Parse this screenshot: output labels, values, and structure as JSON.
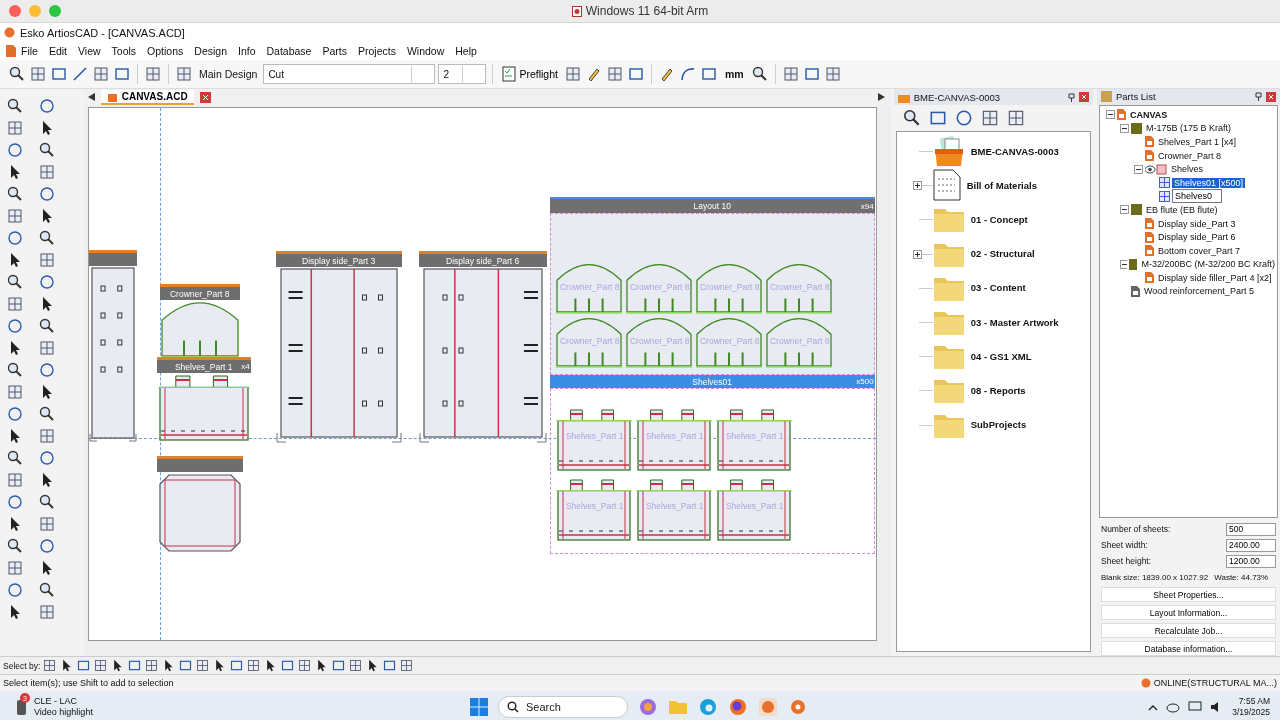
{
  "host_window": {
    "title": "Windows 11 64-bit Arm"
  },
  "app_title": "Esko ArtiosCAD - [CANVAS.ACD]",
  "menu": [
    "File",
    "Edit",
    "View",
    "Tools",
    "Options",
    "Design",
    "Info",
    "Database",
    "Parts",
    "Projects",
    "Window",
    "Help"
  ],
  "toolbar": {
    "design_label": "Main Design",
    "mode_select": {
      "value": "Cut"
    },
    "step_select": {
      "value": "2"
    },
    "preflight": "Preflight",
    "units": "mm"
  },
  "document_tab": {
    "label": "CANVAS.ACD",
    "selected": true
  },
  "canvas": {
    "designs": [
      {
        "kind": "side-panel"
      },
      {
        "kind": "crowner",
        "label": "Crowner_Part 8"
      },
      {
        "kind": "shelf",
        "label": "Shelves_Part 1",
        "count": "x4"
      },
      {
        "kind": "bottom"
      },
      {
        "kind": "display-side",
        "label": "Display side_Part 3"
      },
      {
        "kind": "display-side",
        "label": "Display side_Part 6"
      }
    ],
    "layout": {
      "title": "Layout 10",
      "count": "x94",
      "sheet": {
        "title": "Shelves01",
        "count": "x500"
      },
      "upper_parts": [
        "Crowner_Part 8",
        "Crowner_Part 8",
        "Crowner_Part 8",
        "Crowner_Part 8",
        "Crowner_Part 8",
        "Crowner_Part 8",
        "Crowner_Part 8",
        "Crowner_Part 8"
      ],
      "lower_parts": [
        "Shelves_Part 1",
        "Shelves_Part 1",
        "Shelves_Part 1",
        "Shelves_Part 1",
        "Shelves_Part 1",
        "Shelves_Part 1"
      ]
    }
  },
  "project_panel": {
    "title": "BME-CANVAS-0003",
    "items": [
      {
        "kind": "project",
        "label": "BME-CANVAS-0003",
        "expander": false
      },
      {
        "kind": "document",
        "label": "Bill of Materials",
        "expander": true
      },
      {
        "kind": "folder",
        "label": "01 - Concept",
        "expander": false
      },
      {
        "kind": "folder",
        "label": "02 - Structural",
        "expander": true
      },
      {
        "kind": "folder",
        "label": "03 - Content",
        "expander": false
      },
      {
        "kind": "folder",
        "label": "03 - Master Artwork",
        "expander": false
      },
      {
        "kind": "folder",
        "label": "04 - GS1 XML",
        "expander": false
      },
      {
        "kind": "folder",
        "label": "08 - Reports",
        "expander": false
      },
      {
        "kind": "folder",
        "label": "SubProjects",
        "expander": false
      }
    ]
  },
  "parts_list": {
    "title": "Parts List",
    "tree": [
      {
        "kind": "document",
        "label": "CANVAS",
        "selected": false,
        "expanded": true,
        "children": [
          {
            "kind": "material",
            "label": "M-175B (175 B Kraft)",
            "selected": false,
            "expanded": true,
            "children": [
              {
                "kind": "part",
                "label": "Shelves_Part 1 [x4]",
                "selected": false
              },
              {
                "kind": "part",
                "label": "Crowner_Part 8",
                "selected": false
              },
              {
                "kind": "group",
                "label": "Shelves",
                "selected": false,
                "expanded": true,
                "children": [
                  {
                    "kind": "layout",
                    "label": "Shelves01 [x500]",
                    "selected": true
                  },
                  {
                    "kind": "rename",
                    "label": "Shelves0",
                    "selected": false
                  }
                ]
              }
            ]
          },
          {
            "kind": "material",
            "label": "EB flute (EB flute)",
            "selected": false,
            "expanded": true,
            "children": [
              {
                "kind": "part",
                "label": "Display side_Part 3",
                "selected": false
              },
              {
                "kind": "part",
                "label": "Display side_Part 6",
                "selected": false
              },
              {
                "kind": "part",
                "label": "Bottom cover_Part 7",
                "selected": false
              }
            ]
          },
          {
            "kind": "material",
            "label": "M-32/200BC (M-32/200 BC Kraft)",
            "selected": false,
            "expanded": true,
            "children": [
              {
                "kind": "part",
                "label": "Display side filler_Part 4 [x2]",
                "selected": false
              }
            ]
          },
          {
            "kind": "reinforcement",
            "label": "Wood reinforcement_Part 5",
            "selected": false
          }
        ]
      }
    ]
  },
  "properties": {
    "fields": [
      {
        "label": "Number of sheets:",
        "value": "500"
      },
      {
        "label": "Sheet width:",
        "value": "2400.00"
      },
      {
        "label": "Sheet height:",
        "value": "1200.00"
      }
    ],
    "blank_size": "Blank size: 1839.00 x 1027.92",
    "waste": "Waste: 44.73%",
    "buttons": [
      "Sheet Properties...",
      "Layout Information...",
      "Recalculate Job...",
      "Database information..."
    ]
  },
  "select_bar": {
    "label": "Select by:"
  },
  "status_bar": {
    "message": "Select item(s); use Shift to add to selection",
    "connection": "ONLINE(STRUCTURAL MA...)"
  },
  "taskbar": {
    "notification": {
      "count": "3",
      "title": "CLE - LAC",
      "subtitle": "Video highlight"
    },
    "search": {
      "placeholder": "Search"
    },
    "time": "7:55 AM",
    "date": "3/19/2025"
  }
}
